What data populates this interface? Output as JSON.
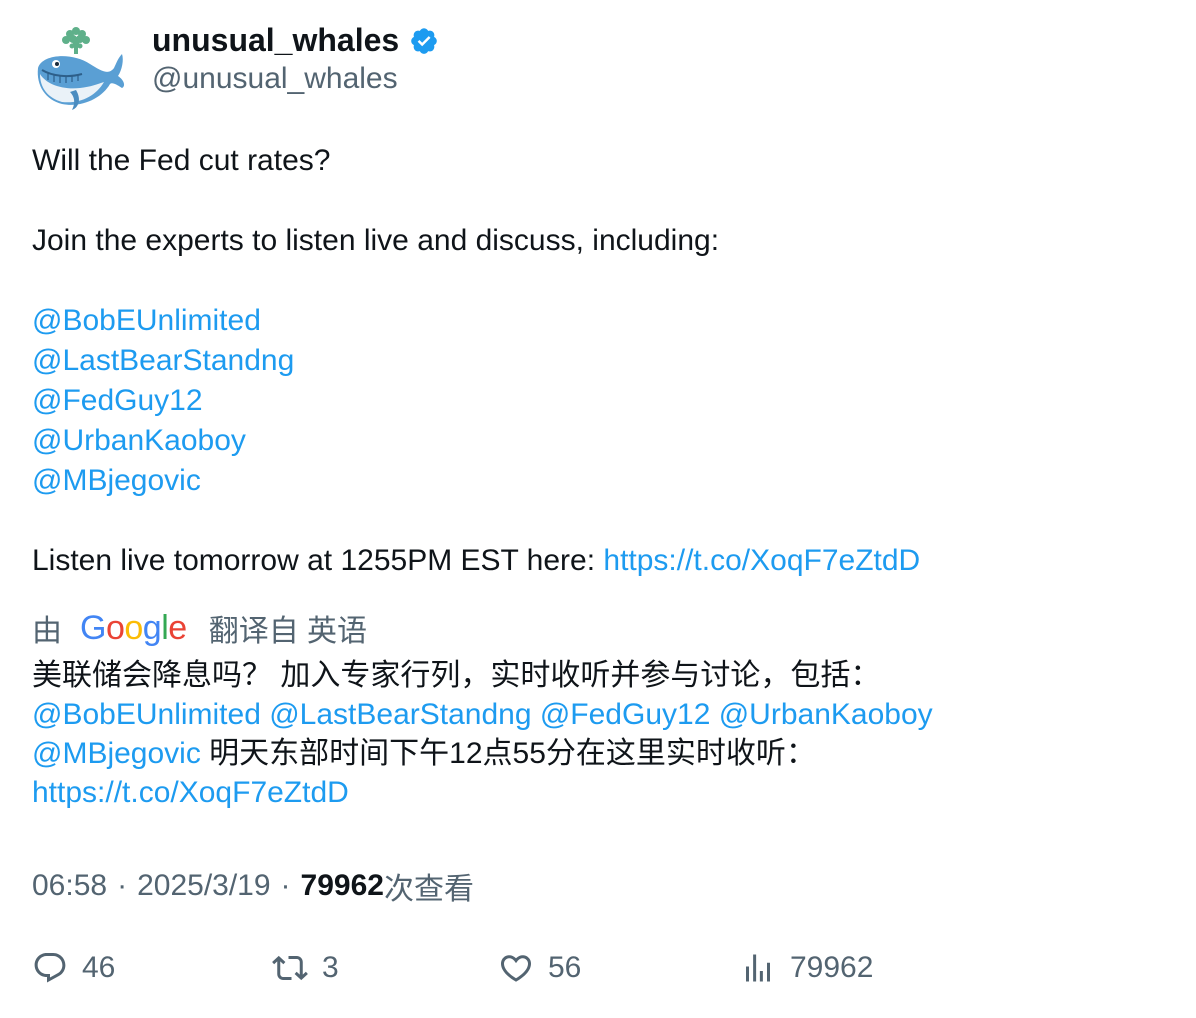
{
  "author": {
    "name": "unusual_whales",
    "handle": "@unusual_whales",
    "verified_color": "#1d9bf0"
  },
  "tweet": {
    "line1": "Will the Fed cut rates?",
    "line2": "Join the experts to listen live and discuss, including:",
    "mentions": [
      "@BobEUnlimited",
      "@LastBearStandng",
      "@FedGuy12",
      "@UrbanKaoboy",
      "@MBjegovic"
    ],
    "listen_text": "Listen live tomorrow at 1255PM EST here: ",
    "link": "https://t.co/XoqF7eZtdD"
  },
  "translation": {
    "by": "由",
    "brand": "Google",
    "from": "翻译自 英语",
    "line1": "美联储会降息吗？ 加入专家行列，实时收听并参与讨论，包括：",
    "line2_mentions": "@BobEUnlimited @LastBearStandng @FedGuy12 @UrbanKaoboy",
    "line3_mention": "@MBjegovic",
    "line3_text": " 明天东部时间下午12点55分在这里实时收听：",
    "line4_link": "https://t.co/XoqF7eZtdD"
  },
  "meta": {
    "time": "06:58",
    "sep": "·",
    "date": "2025/3/19",
    "views_count": "79962",
    "views_label": "次查看"
  },
  "actions": {
    "replies": "46",
    "retweets": "3",
    "likes": "56",
    "views": "79962"
  },
  "icons": [
    "whale-avatar",
    "verified-badge-icon",
    "reply-icon",
    "retweet-icon",
    "like-icon",
    "views-icon"
  ],
  "colors": {
    "link": "#1d9bf0",
    "muted": "#536471",
    "text": "#0f1419"
  }
}
